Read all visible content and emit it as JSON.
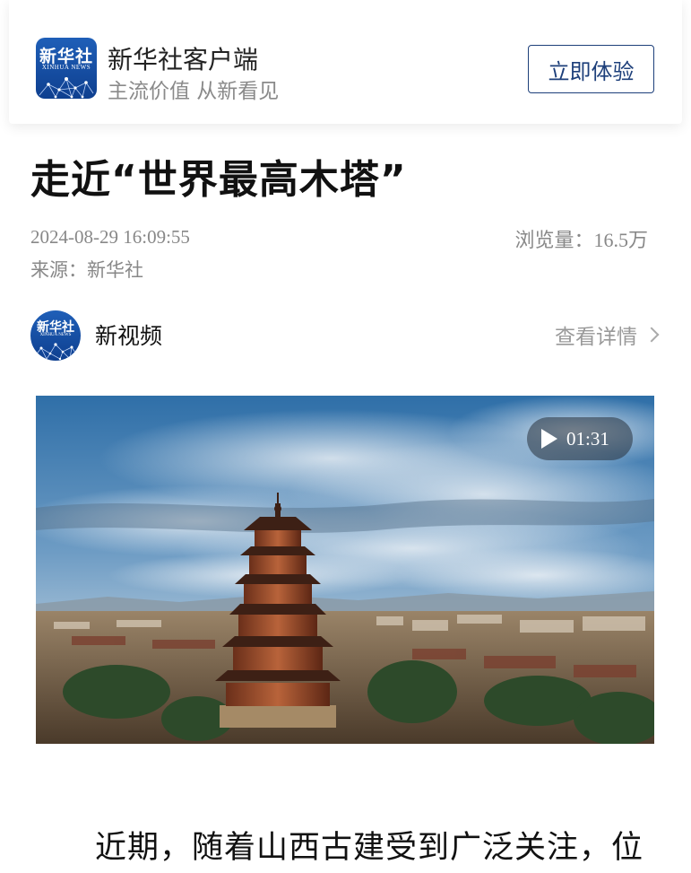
{
  "app_banner": {
    "logo": {
      "cn": "新华社",
      "en": "XINHUA NEWS"
    },
    "name": "新华社客户端",
    "slogan": "主流价值 从新看见",
    "try_button_label": "立即体验"
  },
  "article": {
    "title": "走近“世界最高木塔”",
    "datetime": "2024-08-29 16:09:55",
    "views_label": "浏览量：",
    "views_value": "16.5万",
    "source": "来源：新华社"
  },
  "channel": {
    "avatar": {
      "cn": "新华社",
      "en": "XINHUA NEWS"
    },
    "name": "新视频",
    "details_label": "查看详情"
  },
  "video": {
    "duration": "01:31",
    "play_icon": "play-icon"
  },
  "body": {
    "paragraph_start": "近期，随着山西古建受到广泛关注，位"
  },
  "colors": {
    "brand_blue": "#1d3f7a",
    "logo_blue": "#1f5fb8",
    "meta_gray": "#888888"
  }
}
